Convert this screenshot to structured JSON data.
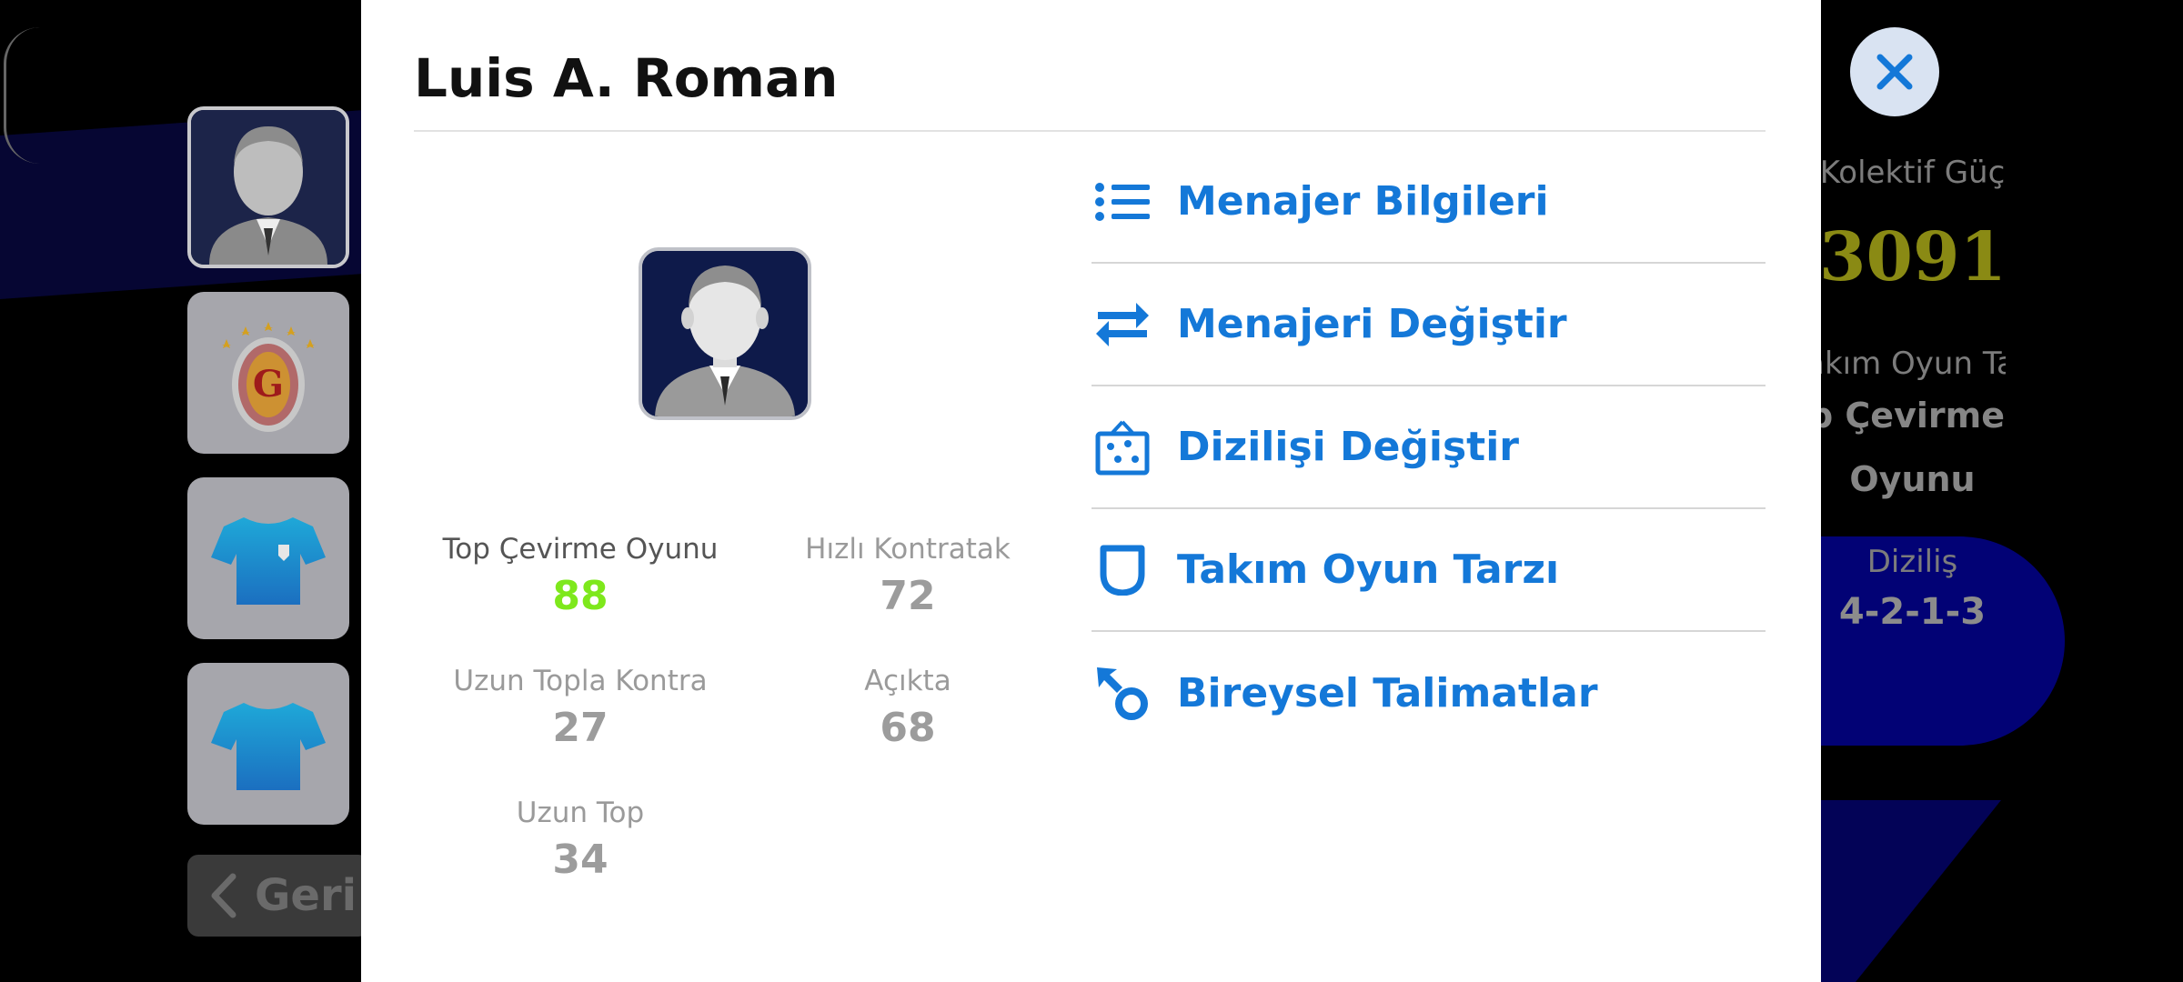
{
  "modal": {
    "title": "Luis A. Roman",
    "stats": [
      {
        "label": "Top Çevirme Oyunu",
        "value": "88",
        "active": true
      },
      {
        "label": "Hızlı Kontratak",
        "value": "72",
        "active": false
      },
      {
        "label": "Uzun Topla Kontra",
        "value": "27",
        "active": false
      },
      {
        "label": "Açıkta",
        "value": "68",
        "active": false
      },
      {
        "label": "Uzun Top",
        "value": "34",
        "active": false
      }
    ],
    "menu": [
      {
        "label": "Menajer Bilgileri",
        "icon": "list-icon"
      },
      {
        "label": "Menajeri Değiştir",
        "icon": "swap-arrows-icon"
      },
      {
        "label": "Dizilişi Değiştir",
        "icon": "formation-board-icon"
      },
      {
        "label": "Takım Oyun Tarzı",
        "icon": "shield-icon"
      },
      {
        "label": "Bireysel Talimatlar",
        "icon": "player-instruction-icon"
      }
    ]
  },
  "background": {
    "collective_power_label": "Kolektif Güç",
    "collective_power_value": "3091",
    "team_style_label": "Takım Oyun Tarzı",
    "team_style_value_line1": "Top Çevirme",
    "team_style_value_line2": "Oyunu",
    "formation_label": "Diziliş",
    "formation_value": "4-2-1-3",
    "back_label": "Geri"
  },
  "colors": {
    "accent_blue": "#1478d8",
    "highlight_green": "#7ee81c",
    "power_yellow": "#8a8a14"
  }
}
